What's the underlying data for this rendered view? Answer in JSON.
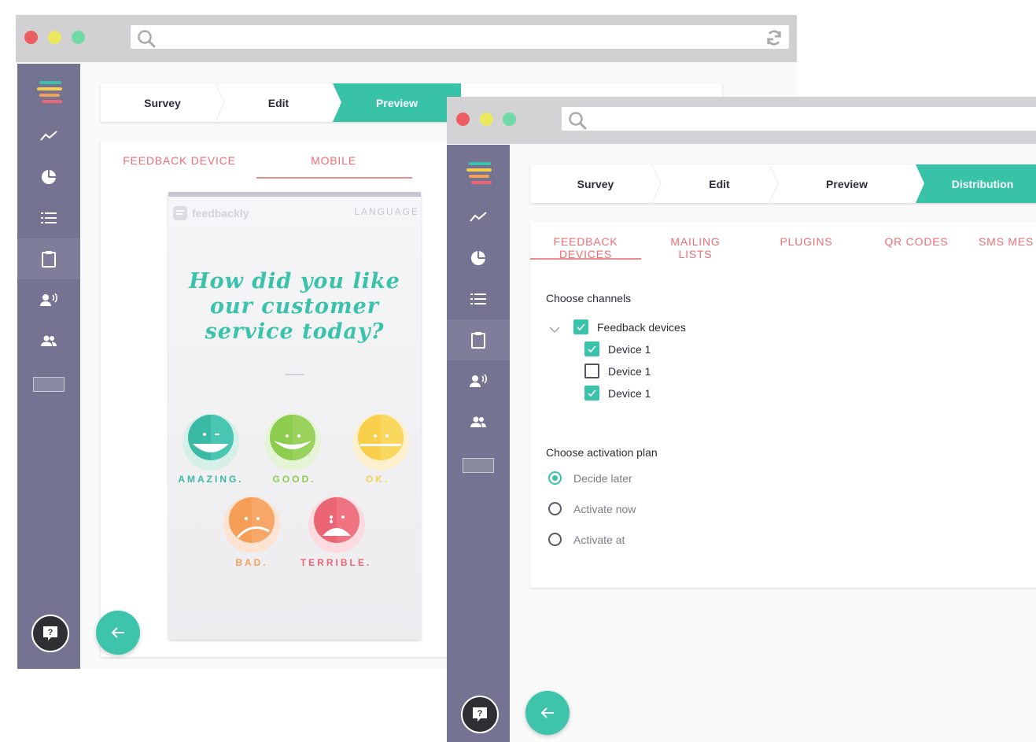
{
  "back_window": {
    "steps": [
      "Survey",
      "Edit",
      "Preview"
    ],
    "active_step": "Preview",
    "tabs": [
      "FEEDBACK DEVICE",
      "MOBILE"
    ],
    "active_tab": "MOBILE",
    "preview": {
      "brand": "feedbackly",
      "language_label": "LANGUAGE",
      "question": "How did you like our customer service today?",
      "options": [
        {
          "label": "AMAZING.",
          "color": "#3ab9a4"
        },
        {
          "label": "GOOD.",
          "color": "#8ccc4e"
        },
        {
          "label": "OK.",
          "color": "#f8cf4a"
        },
        {
          "label": "BAD.",
          "color": "#f59e58"
        },
        {
          "label": "TERRIBLE.",
          "color": "#ec6574"
        }
      ]
    }
  },
  "front_window": {
    "steps": [
      "Survey",
      "Edit",
      "Preview",
      "Distribution"
    ],
    "active_step": "Distribution",
    "tabs": [
      "FEEDBACK DEVICES",
      "MAILING LISTS",
      "PLUGINS",
      "QR CODES",
      "SMS MES"
    ],
    "active_tab": "FEEDBACK DEVICES",
    "channels": {
      "title": "Choose channels",
      "group": {
        "label": "Feedback devices",
        "checked": true
      },
      "devices": [
        {
          "label": "Device 1",
          "checked": true
        },
        {
          "label": "Device 1",
          "checked": false
        },
        {
          "label": "Device 1",
          "checked": true
        }
      ]
    },
    "activation": {
      "title": "Choose activation plan",
      "options": [
        {
          "label": "Decide later",
          "selected": true
        },
        {
          "label": "Activate now",
          "selected": false
        },
        {
          "label": "Activate at",
          "selected": false
        }
      ]
    }
  },
  "sidebar_icons": [
    "logo-icon",
    "analytics-icon",
    "pie-chart-icon",
    "list-icon",
    "clipboard-icon",
    "speaker-icon",
    "users-icon",
    "image-placeholder"
  ],
  "help_label": "?",
  "colors": {
    "accent": "#38c2a8",
    "sidebar": "#747492",
    "tab_text": "#ec6e73"
  }
}
